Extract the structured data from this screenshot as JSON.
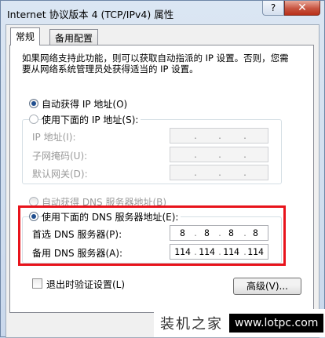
{
  "window": {
    "title": "Internet 协议版本 4 (TCP/IPv4) 属性",
    "help_label": "?",
    "close_label": "✕"
  },
  "tabs": [
    {
      "label": "常规"
    },
    {
      "label": "备用配置"
    }
  ],
  "description": "如果网络支持此功能，则可以获取自动指派的 IP 设置。否则，您需要从网络系统管理员处获得适当的 IP 设置。",
  "ip_section": {
    "auto_label": "自动获得 IP 地址(O)",
    "manual_label": "使用下面的 IP 地址(S):",
    "ip_label": "IP 地址(I):",
    "mask_label": "子网掩码(U):",
    "gateway_label": "默认网关(D):"
  },
  "dns_section": {
    "auto_label": "自动获得 DNS 服务器地址(B)",
    "manual_label": "使用下面的 DNS 服务器地址(E):",
    "preferred_label": "首选 DNS 服务器(P):",
    "alternate_label": "备用 DNS 服务器(A):",
    "preferred": [
      "8",
      "8",
      "8",
      "8"
    ],
    "alternate": [
      "114",
      "114",
      "114",
      "114"
    ]
  },
  "validate_label": "退出时验证设置(L)",
  "advanced_label": "高级(V)...",
  "watermark": {
    "cn": "装机之家",
    "url": "www.lotpc.com"
  },
  "colors": {
    "highlight": "#e8131b",
    "close": "#c75440",
    "selected_radio": "#1f4e8f"
  }
}
